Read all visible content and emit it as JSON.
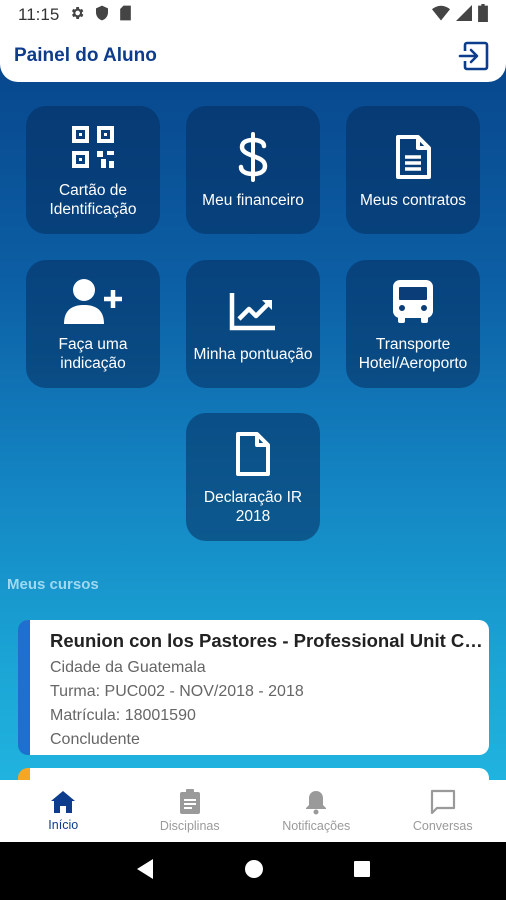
{
  "status_bar": {
    "time": "11:15"
  },
  "header": {
    "title": "Painel do Aluno"
  },
  "tiles": [
    {
      "label": "Cartão de Identificação",
      "icon": "qr-code-icon"
    },
    {
      "label": "Meu financeiro",
      "icon": "dollar-icon"
    },
    {
      "label": "Meus contratos",
      "icon": "document-icon"
    },
    {
      "label": "Faça uma indicação",
      "icon": "user-plus-icon"
    },
    {
      "label": "Minha pontuação",
      "icon": "chart-icon"
    },
    {
      "label": "Transporte Hotel/Aeroporto",
      "icon": "bus-icon"
    },
    {
      "label": "Declaração IR 2018",
      "icon": "file-icon"
    }
  ],
  "courses_section": {
    "label": "Meus cursos",
    "courses": [
      {
        "title": "Reunion con los Pastores - Professional Unit Co...",
        "city": "Cidade da Guatemala",
        "class": "Turma: PUC002 - NOV/2018 - 2018",
        "enrollment": "Matrícula: 18001590",
        "status": "Concludente",
        "accent": "#1f6fd1"
      }
    ]
  },
  "bottom_nav": [
    {
      "label": "Início",
      "icon": "home-icon",
      "active": true
    },
    {
      "label": "Disciplinas",
      "icon": "clipboard-icon",
      "active": false
    },
    {
      "label": "Notificações",
      "icon": "bell-icon",
      "active": false
    },
    {
      "label": "Conversas",
      "icon": "chat-icon",
      "active": false
    }
  ],
  "colors": {
    "brand": "#0d3c8c",
    "gradient_top": "#08478d",
    "gradient_bottom": "#21b3df",
    "tile_bg": "#062d5f",
    "second_card_accent": "#f5a623"
  }
}
